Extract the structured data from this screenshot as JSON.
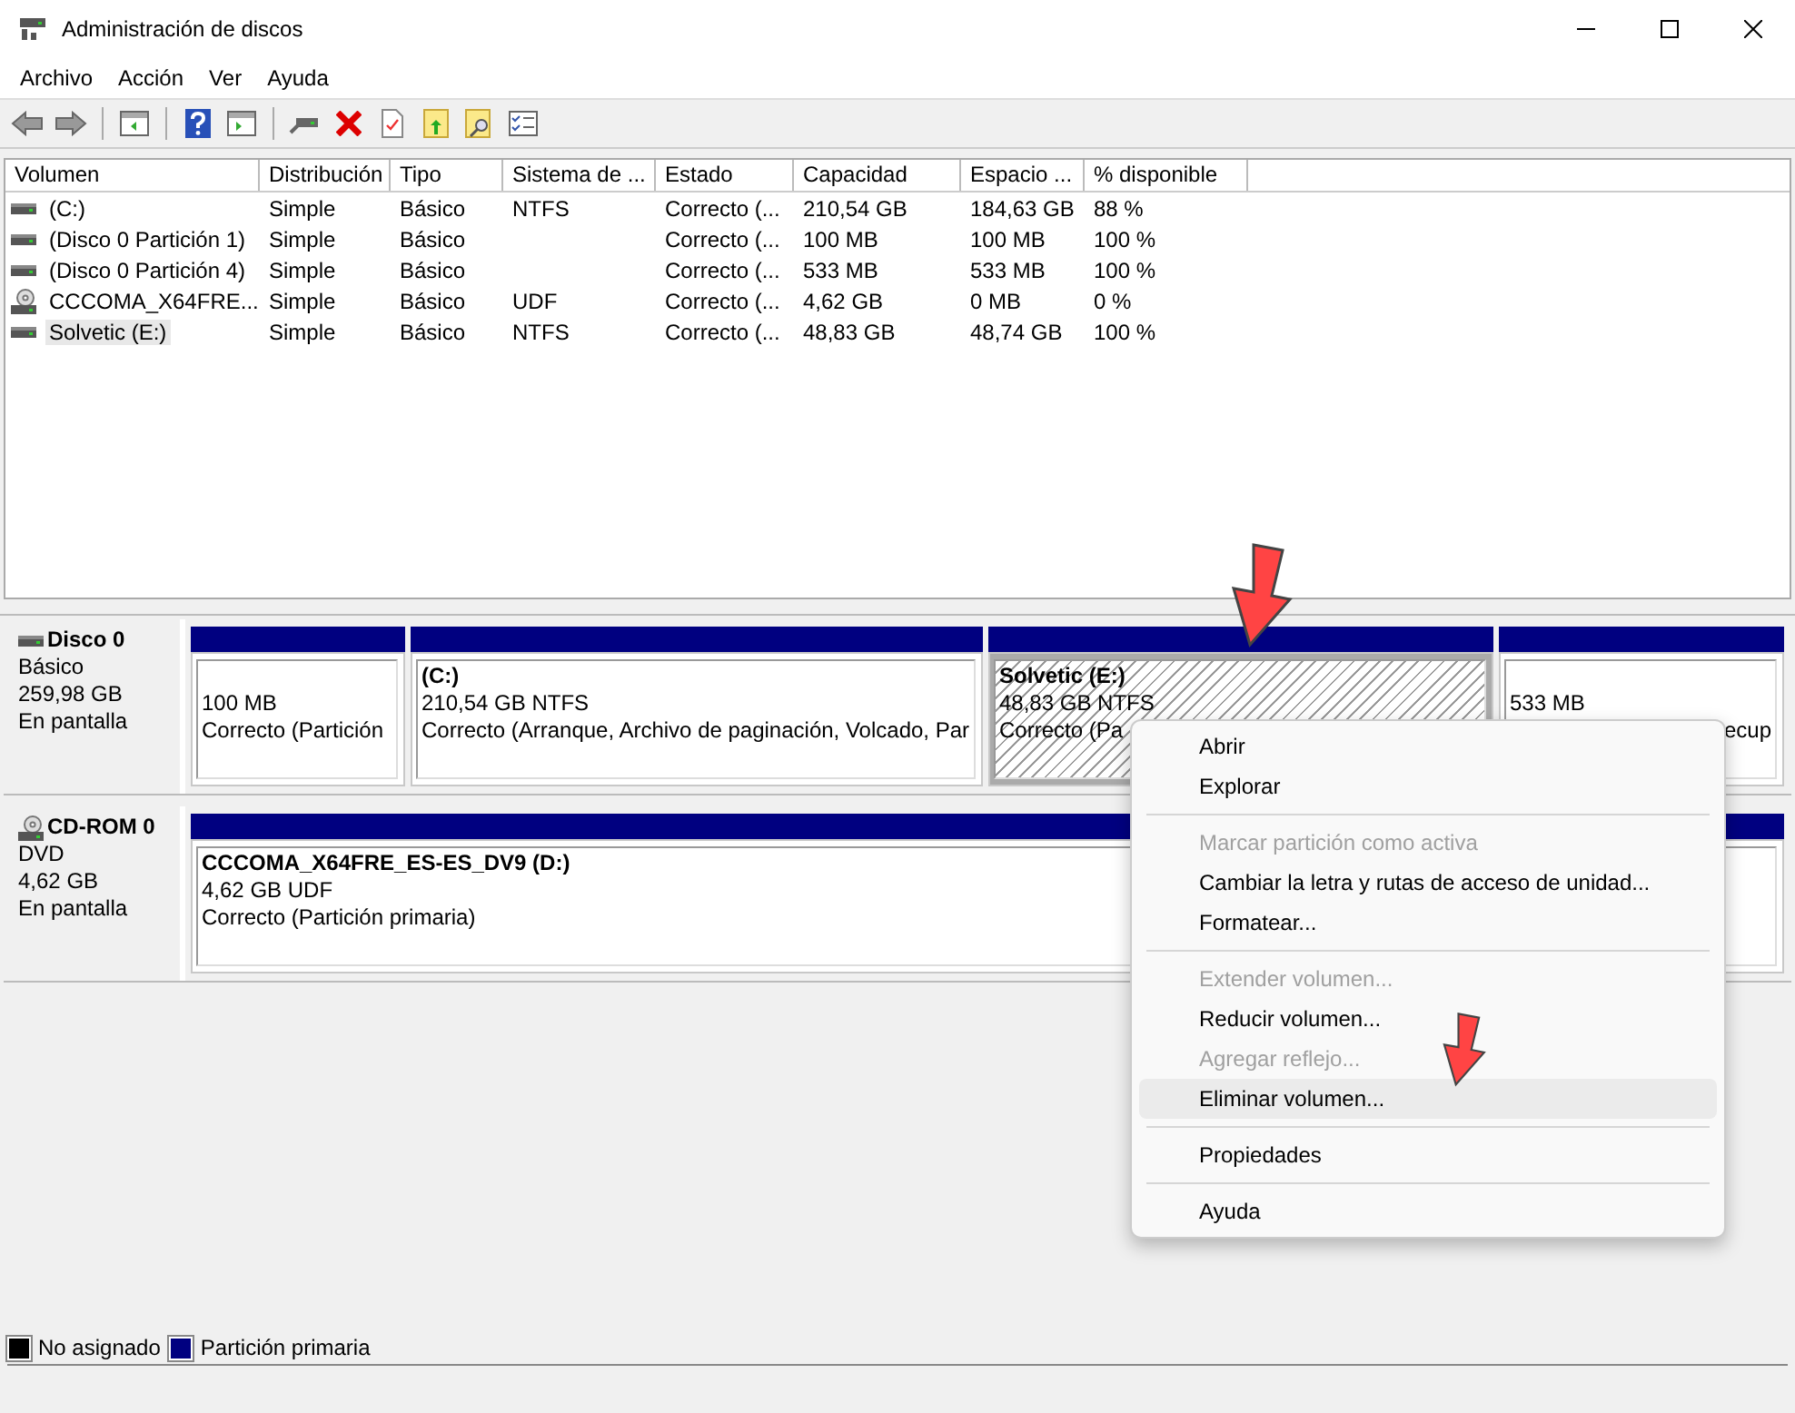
{
  "window": {
    "title": "Administración de discos"
  },
  "menu_bar": [
    "Archivo",
    "Acción",
    "Ver",
    "Ayuda"
  ],
  "volume_table": {
    "columns": [
      "Volumen",
      "Distribución",
      "Tipo",
      "Sistema de ...",
      "Estado",
      "Capacidad",
      "Espacio ...",
      "% disponible"
    ],
    "rows": [
      {
        "kind": "disk",
        "selected": false,
        "cells": [
          "(C:)",
          "Simple",
          "Básico",
          "NTFS",
          "Correcto (...",
          "210,54 GB",
          "184,63 GB",
          "88 %"
        ]
      },
      {
        "kind": "disk",
        "selected": false,
        "cells": [
          "(Disco 0 Partición 1)",
          "Simple",
          "Básico",
          "",
          "Correcto (...",
          "100 MB",
          "100 MB",
          "100 %"
        ]
      },
      {
        "kind": "disk",
        "selected": false,
        "cells": [
          "(Disco 0 Partición 4)",
          "Simple",
          "Básico",
          "",
          "Correcto (...",
          "533 MB",
          "533 MB",
          "100 %"
        ]
      },
      {
        "kind": "cd",
        "selected": false,
        "cells": [
          "CCCOMA_X64FRE...",
          "Simple",
          "Básico",
          "UDF",
          "Correcto (...",
          "4,62 GB",
          "0 MB",
          "0 %"
        ]
      },
      {
        "kind": "disk",
        "selected": true,
        "cells": [
          "Solvetic (E:)",
          "Simple",
          "Básico",
          "NTFS",
          "Correcto (...",
          "48,83 GB",
          "48,74 GB",
          "100 %"
        ]
      }
    ]
  },
  "disks": [
    {
      "kind": "disk",
      "name": "Disco 0",
      "type": "Básico",
      "size": "259,98 GB",
      "status": "En pantalla",
      "partitions": [
        {
          "size": "100 MB",
          "status": "Correcto (Partición",
          "selected": false
        },
        {
          "name": "(C:)",
          "size": "210,54 GB NTFS",
          "status": "Correcto (Arranque, Archivo de paginación, Volcado, Par",
          "selected": false
        },
        {
          "name": "Solvetic  (E:)",
          "size": "48,83 GB NTFS",
          "status": "Correcto (Pa",
          "selected": true
        },
        {
          "size": "533 MB",
          "status": "ecup",
          "selected": false
        }
      ]
    },
    {
      "kind": "cd",
      "name": "CD-ROM 0",
      "type": "DVD",
      "size": "4,62 GB",
      "status": "En pantalla",
      "partitions": [
        {
          "name": "CCCOMA_X64FRE_ES-ES_DV9  (D:)",
          "size": "4,62 GB UDF",
          "status": "Correcto (Partición primaria)",
          "selected": false
        }
      ]
    }
  ],
  "context_menu": [
    {
      "kind": "item",
      "label": "Abrir",
      "disabled": false,
      "highlighted": false
    },
    {
      "kind": "item",
      "label": "Explorar",
      "disabled": false,
      "highlighted": false
    },
    {
      "kind": "separator"
    },
    {
      "kind": "item",
      "label": "Marcar partición como activa",
      "disabled": true,
      "highlighted": false
    },
    {
      "kind": "item",
      "label": "Cambiar la letra y rutas de acceso de unidad...",
      "disabled": false,
      "highlighted": false
    },
    {
      "kind": "item",
      "label": "Formatear...",
      "disabled": false,
      "highlighted": false
    },
    {
      "kind": "separator"
    },
    {
      "kind": "item",
      "label": "Extender volumen...",
      "disabled": true,
      "highlighted": false
    },
    {
      "kind": "item",
      "label": "Reducir volumen...",
      "disabled": false,
      "highlighted": false
    },
    {
      "kind": "item",
      "label": "Agregar reflejo...",
      "disabled": true,
      "highlighted": false
    },
    {
      "kind": "item",
      "label": "Eliminar volumen...",
      "disabled": false,
      "highlighted": true
    },
    {
      "kind": "separator"
    },
    {
      "kind": "item",
      "label": "Propiedades",
      "disabled": false,
      "highlighted": false
    },
    {
      "kind": "separator"
    },
    {
      "kind": "item",
      "label": "Ayuda",
      "disabled": false,
      "highlighted": false
    }
  ],
  "legend": [
    {
      "label": "No asignado",
      "color": "#000000"
    },
    {
      "label": "Partición primaria",
      "color": "#000080"
    }
  ]
}
